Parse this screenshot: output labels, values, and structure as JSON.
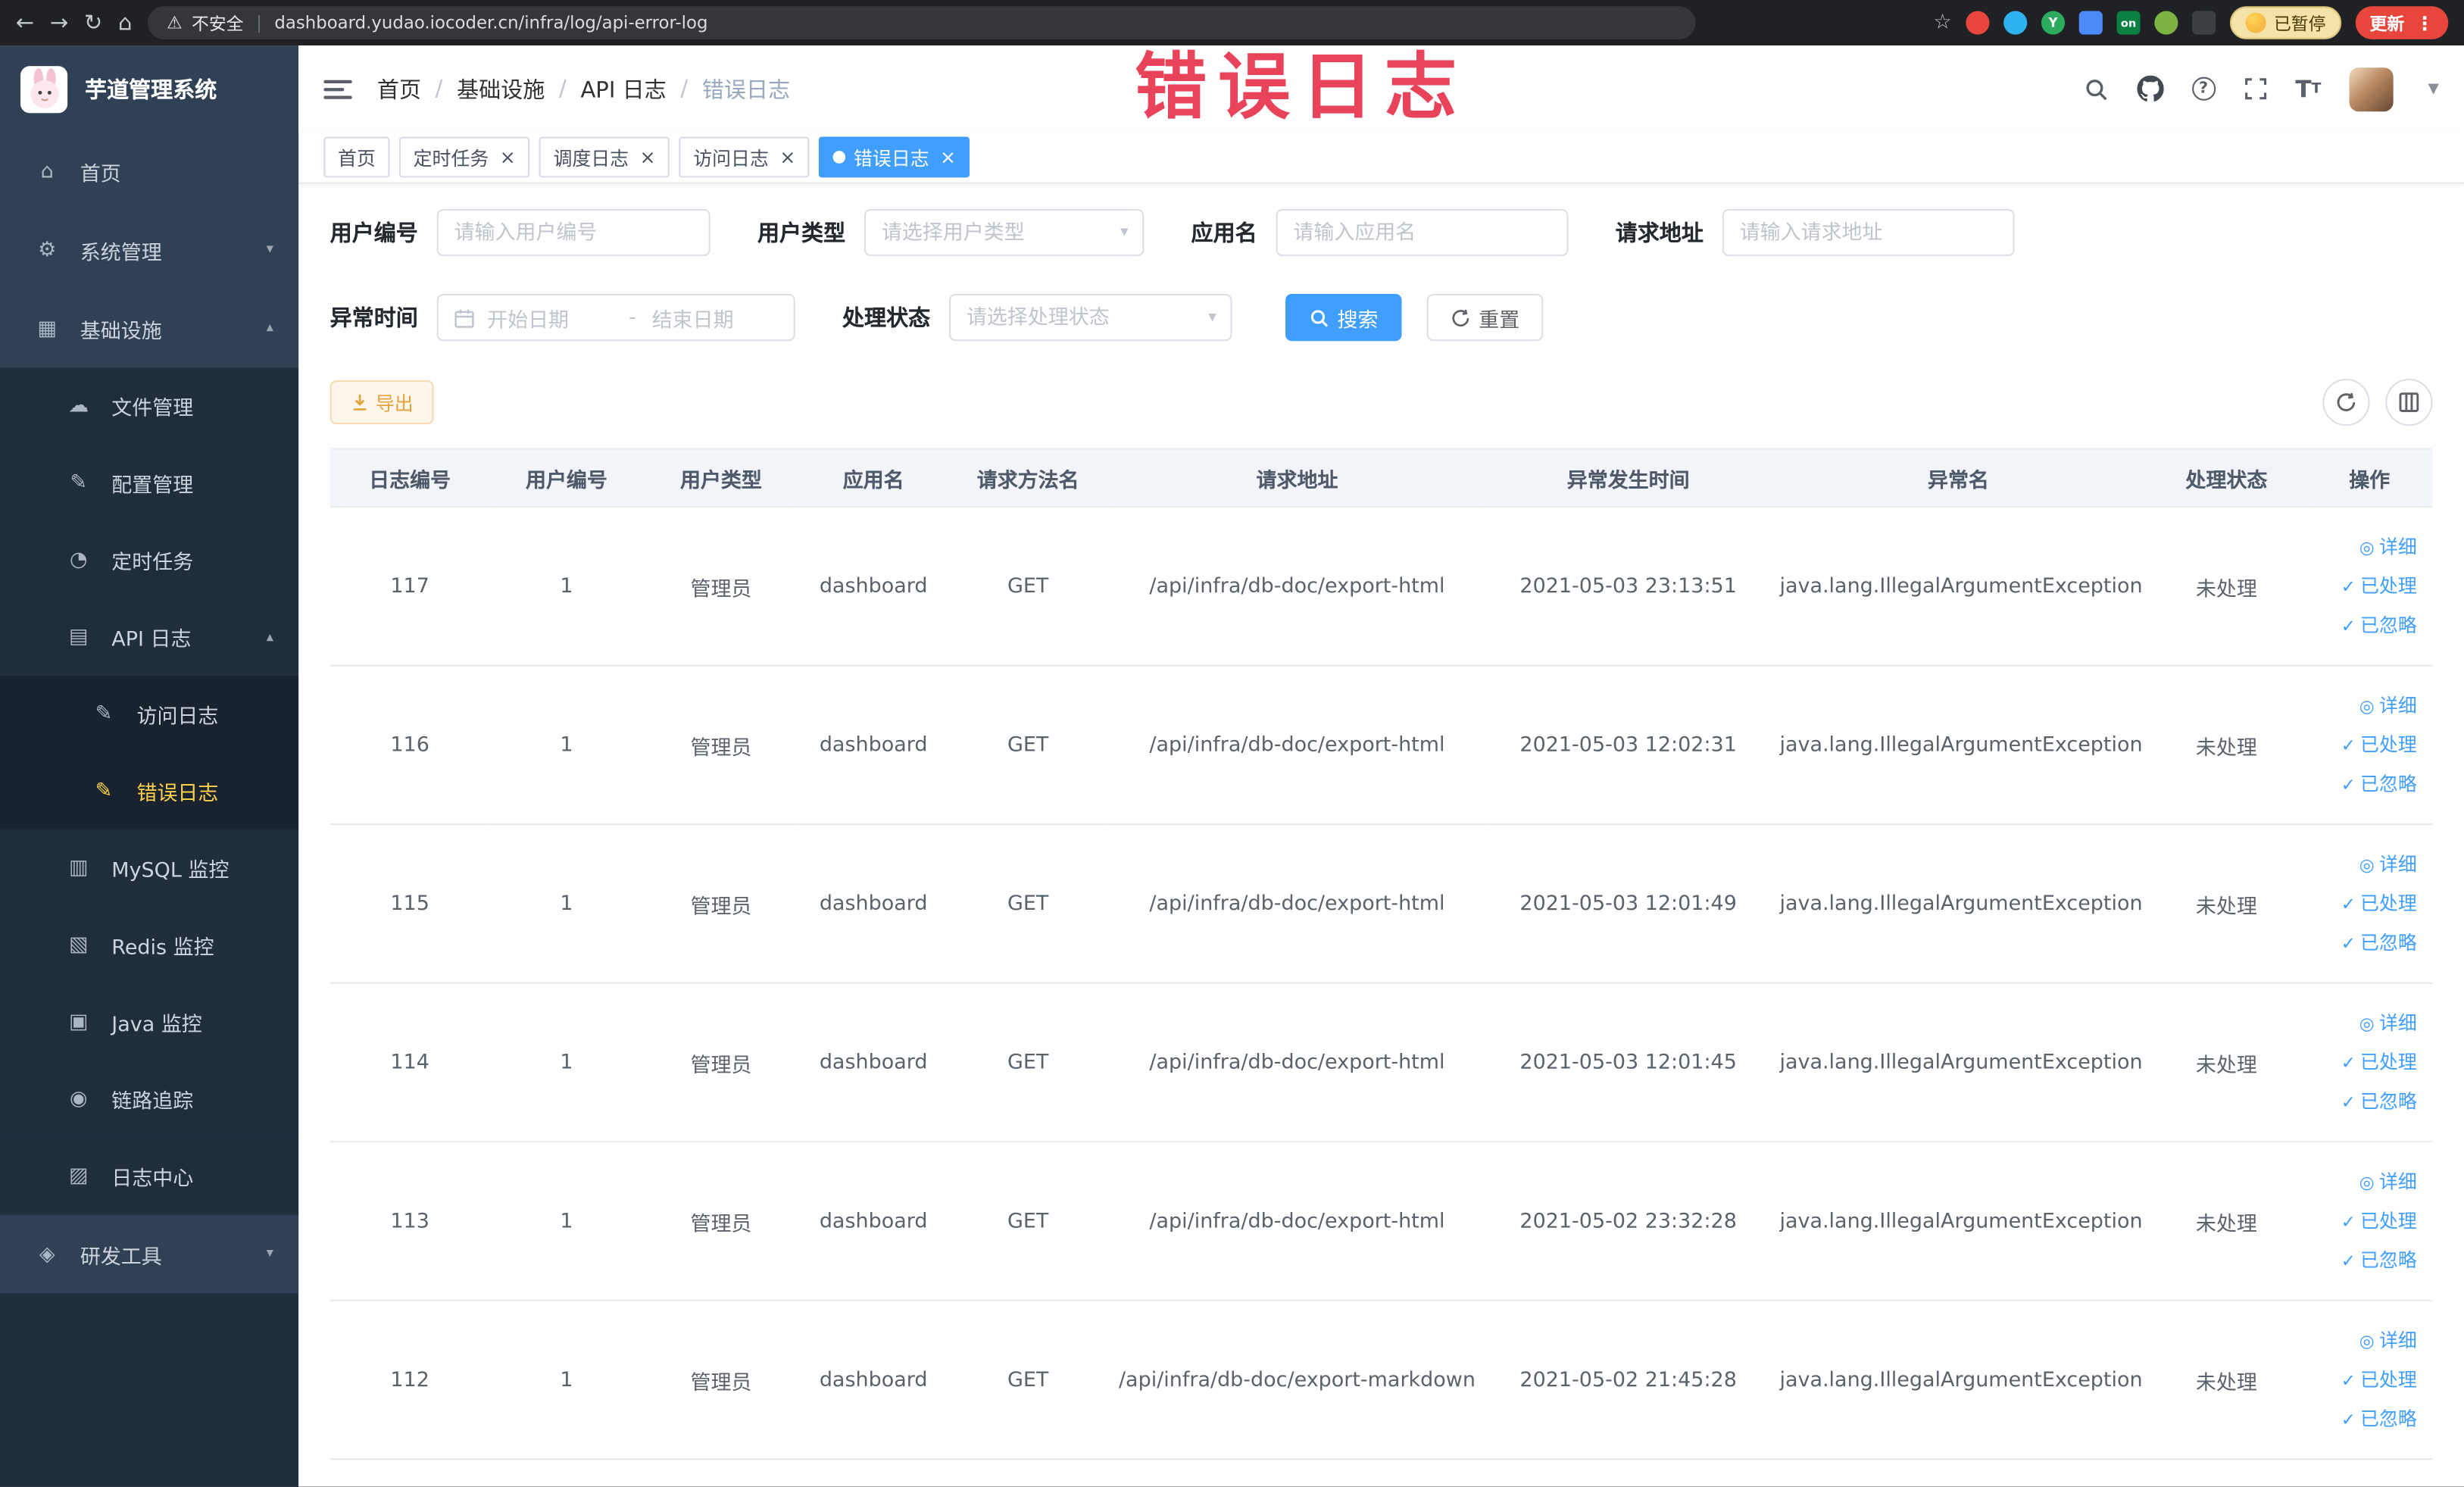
{
  "browser": {
    "security_label": "不安全",
    "url": "dashboard.yudao.iocoder.cn/infra/log/api-error-log",
    "ext_y_badge": "Y",
    "ext_on_badge": "on",
    "paused_label": "已暂停",
    "update_label": "更新"
  },
  "watermark_text": "错误日志",
  "sidebar": {
    "app_title": "芋道管理系统",
    "items": [
      {
        "label": "首页",
        "level": 1,
        "icon": "home"
      },
      {
        "label": "系统管理",
        "level": 1,
        "icon": "system",
        "arrow": "down"
      },
      {
        "label": "基础设施",
        "level": 1,
        "icon": "infrastructure",
        "arrow": "up"
      },
      {
        "label": "文件管理",
        "level": 2,
        "icon": "file-manage"
      },
      {
        "label": "配置管理",
        "level": 2,
        "icon": "config-manage"
      },
      {
        "label": "定时任务",
        "level": 2,
        "icon": "cron-job"
      },
      {
        "label": "API 日志",
        "level": 2,
        "icon": "api-log",
        "arrow": "up"
      },
      {
        "label": "访问日志",
        "level": 3,
        "icon": "access-log"
      },
      {
        "label": "错误日志",
        "level": 3,
        "icon": "error-log",
        "active": true
      },
      {
        "label": "MySQL 监控",
        "level": 2,
        "icon": "mysql-monitor"
      },
      {
        "label": "Redis 监控",
        "level": 2,
        "icon": "redis-monitor"
      },
      {
        "label": "Java 监控",
        "level": 2,
        "icon": "java-monitor"
      },
      {
        "label": "链路追踪",
        "level": 2,
        "icon": "link-trace"
      },
      {
        "label": "日志中心",
        "level": 2,
        "icon": "log-center"
      },
      {
        "label": "研发工具",
        "level": 1,
        "icon": "dev-tools",
        "arrow": "down"
      }
    ]
  },
  "breadcrumb": [
    "首页",
    "基础设施",
    "API 日志",
    "错误日志"
  ],
  "tabs": [
    {
      "label": "首页",
      "closable": false,
      "active": false
    },
    {
      "label": "定时任务",
      "closable": true,
      "active": false
    },
    {
      "label": "调度日志",
      "closable": true,
      "active": false
    },
    {
      "label": "访问日志",
      "closable": true,
      "active": false
    },
    {
      "label": "错误日志",
      "closable": true,
      "active": true
    }
  ],
  "filters": {
    "user_id": {
      "label": "用户编号",
      "placeholder": "请输入用户编号"
    },
    "user_type": {
      "label": "用户类型",
      "placeholder": "请选择用户类型"
    },
    "app_name": {
      "label": "应用名",
      "placeholder": "请输入应用名"
    },
    "request_url": {
      "label": "请求地址",
      "placeholder": "请输入请求地址"
    },
    "exception_time": {
      "label": "异常时间",
      "start_placeholder": "开始日期",
      "separator": "-",
      "end_placeholder": "结束日期"
    },
    "process_status": {
      "label": "处理状态",
      "placeholder": "请选择处理状态"
    },
    "search_label": "搜索",
    "reset_label": "重置"
  },
  "toolbar": {
    "export_label": "导出"
  },
  "table": {
    "columns": [
      "日志编号",
      "用户编号",
      "用户类型",
      "应用名",
      "请求方法名",
      "请求地址",
      "异常发生时间",
      "异常名",
      "处理状态",
      "操作"
    ],
    "actions": {
      "detail_label": "详细",
      "processed_label": "已处理",
      "ignore_label": "已忽略"
    },
    "rows": [
      [
        "117",
        "1",
        "管理员",
        "dashboard",
        "GET",
        "/api/infra/db-doc/export-html",
        "2021-05-03 23:13:51",
        "java.lang.IllegalArgumentException",
        "未处理"
      ],
      [
        "116",
        "1",
        "管理员",
        "dashboard",
        "GET",
        "/api/infra/db-doc/export-html",
        "2021-05-03 12:02:31",
        "java.lang.IllegalArgumentException",
        "未处理"
      ],
      [
        "115",
        "1",
        "管理员",
        "dashboard",
        "GET",
        "/api/infra/db-doc/export-html",
        "2021-05-03 12:01:49",
        "java.lang.IllegalArgumentException",
        "未处理"
      ],
      [
        "114",
        "1",
        "管理员",
        "dashboard",
        "GET",
        "/api/infra/db-doc/export-html",
        "2021-05-03 12:01:45",
        "java.lang.IllegalArgumentException",
        "未处理"
      ],
      [
        "113",
        "1",
        "管理员",
        "dashboard",
        "GET",
        "/api/infra/db-doc/export-html",
        "2021-05-02 23:32:28",
        "java.lang.IllegalArgumentException",
        "未处理"
      ],
      [
        "112",
        "1",
        "管理员",
        "dashboard",
        "GET",
        "/api/infra/db-doc/export-markdown",
        "2021-05-02 21:45:28",
        "java.lang.IllegalArgumentException",
        "未处理"
      ]
    ]
  },
  "colors": {
    "accent_blue": "#409eff",
    "menu_active_text": "#ffd04b",
    "sidebar_bg": "#304156",
    "submenu_bg": "#1f2d3d",
    "warning_orange": "#e6a23c",
    "watermark_red": "#e9435c",
    "status_unprocessed_text": "#5b6269"
  }
}
